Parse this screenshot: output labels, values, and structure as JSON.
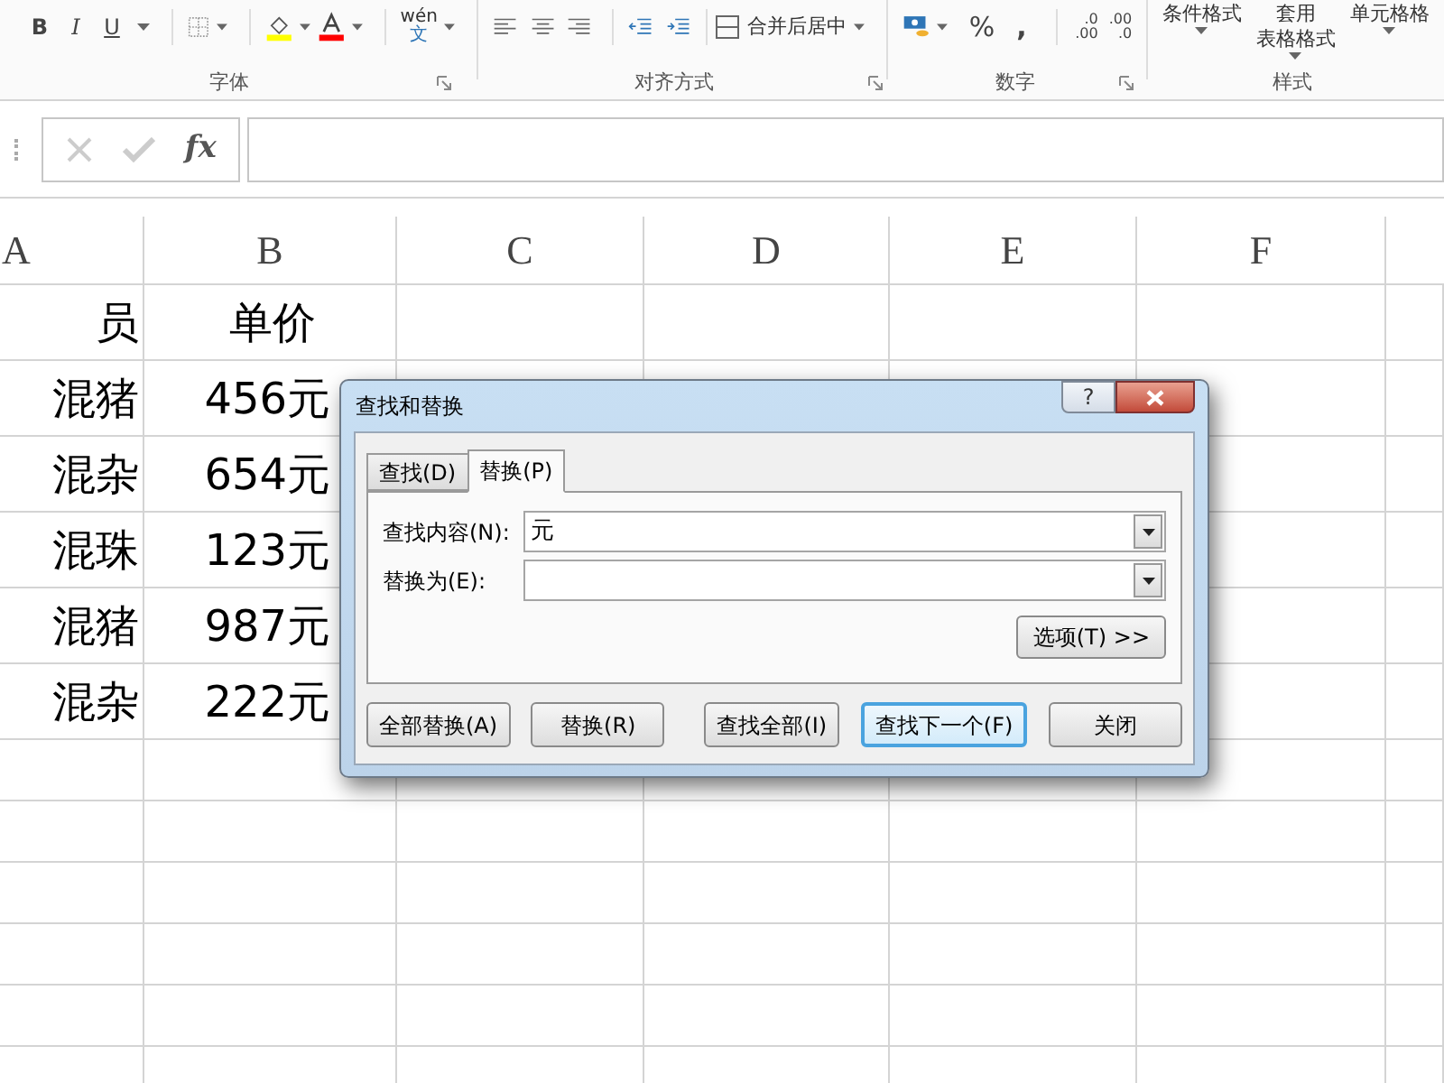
{
  "ribbon": {
    "font_buttons": [
      {
        "label": "B",
        "kind": "bold"
      },
      {
        "label": "I",
        "kind": "italic"
      },
      {
        "label": "U",
        "kind": "underline"
      }
    ],
    "phonetic": {
      "top": "wén",
      "bottom": "文"
    },
    "merge_button": "合并后居中",
    "number_buttons": {
      "percent": "%",
      "comma": ","
    },
    "decimal_buttons": [
      {
        "top": ".0",
        "bottom": ".00"
      },
      {
        "top": ".00",
        "bottom": ".0"
      }
    ],
    "style_buttons": [
      {
        "lines": [
          "条件格式"
        ]
      },
      {
        "lines": [
          "套用",
          "表格格式"
        ]
      },
      {
        "lines": [
          "单元格格"
        ]
      }
    ],
    "groups": [
      {
        "label": "字体",
        "launcher": true
      },
      {
        "label": "对齐方式",
        "launcher": true
      },
      {
        "label": "数字",
        "launcher": true
      },
      {
        "label": "样式",
        "launcher": false
      }
    ]
  },
  "formula_bar": {
    "fx": "fx"
  },
  "sheet": {
    "columns": [
      "A",
      "B",
      "C",
      "D",
      "E",
      "F"
    ],
    "rows": [
      [
        "员",
        "单价"
      ],
      [
        "混猪",
        "456元"
      ],
      [
        "混杂",
        "654元"
      ],
      [
        "混珠",
        "123元"
      ],
      [
        "混猪",
        "987元"
      ],
      [
        "混杂",
        "222元"
      ]
    ]
  },
  "dialog": {
    "title": "查找和替换",
    "help": "?",
    "tabs": [
      {
        "label": "查找(D)",
        "selected": false
      },
      {
        "label": "替换(P)",
        "selected": true
      }
    ],
    "fields": [
      {
        "label": "查找内容(N):",
        "value": "元"
      },
      {
        "label": "替换为(E):"
      }
    ],
    "options_button": "选项(T) >>",
    "buttons": [
      {
        "label": "全部替换(A)",
        "default": false
      },
      {
        "label": "替换(R)",
        "default": false
      },
      {
        "label": "查找全部(I)",
        "default": false
      },
      {
        "label": "查找下一个(F)",
        "default": true
      },
      {
        "label": "关闭",
        "default": false
      }
    ]
  }
}
